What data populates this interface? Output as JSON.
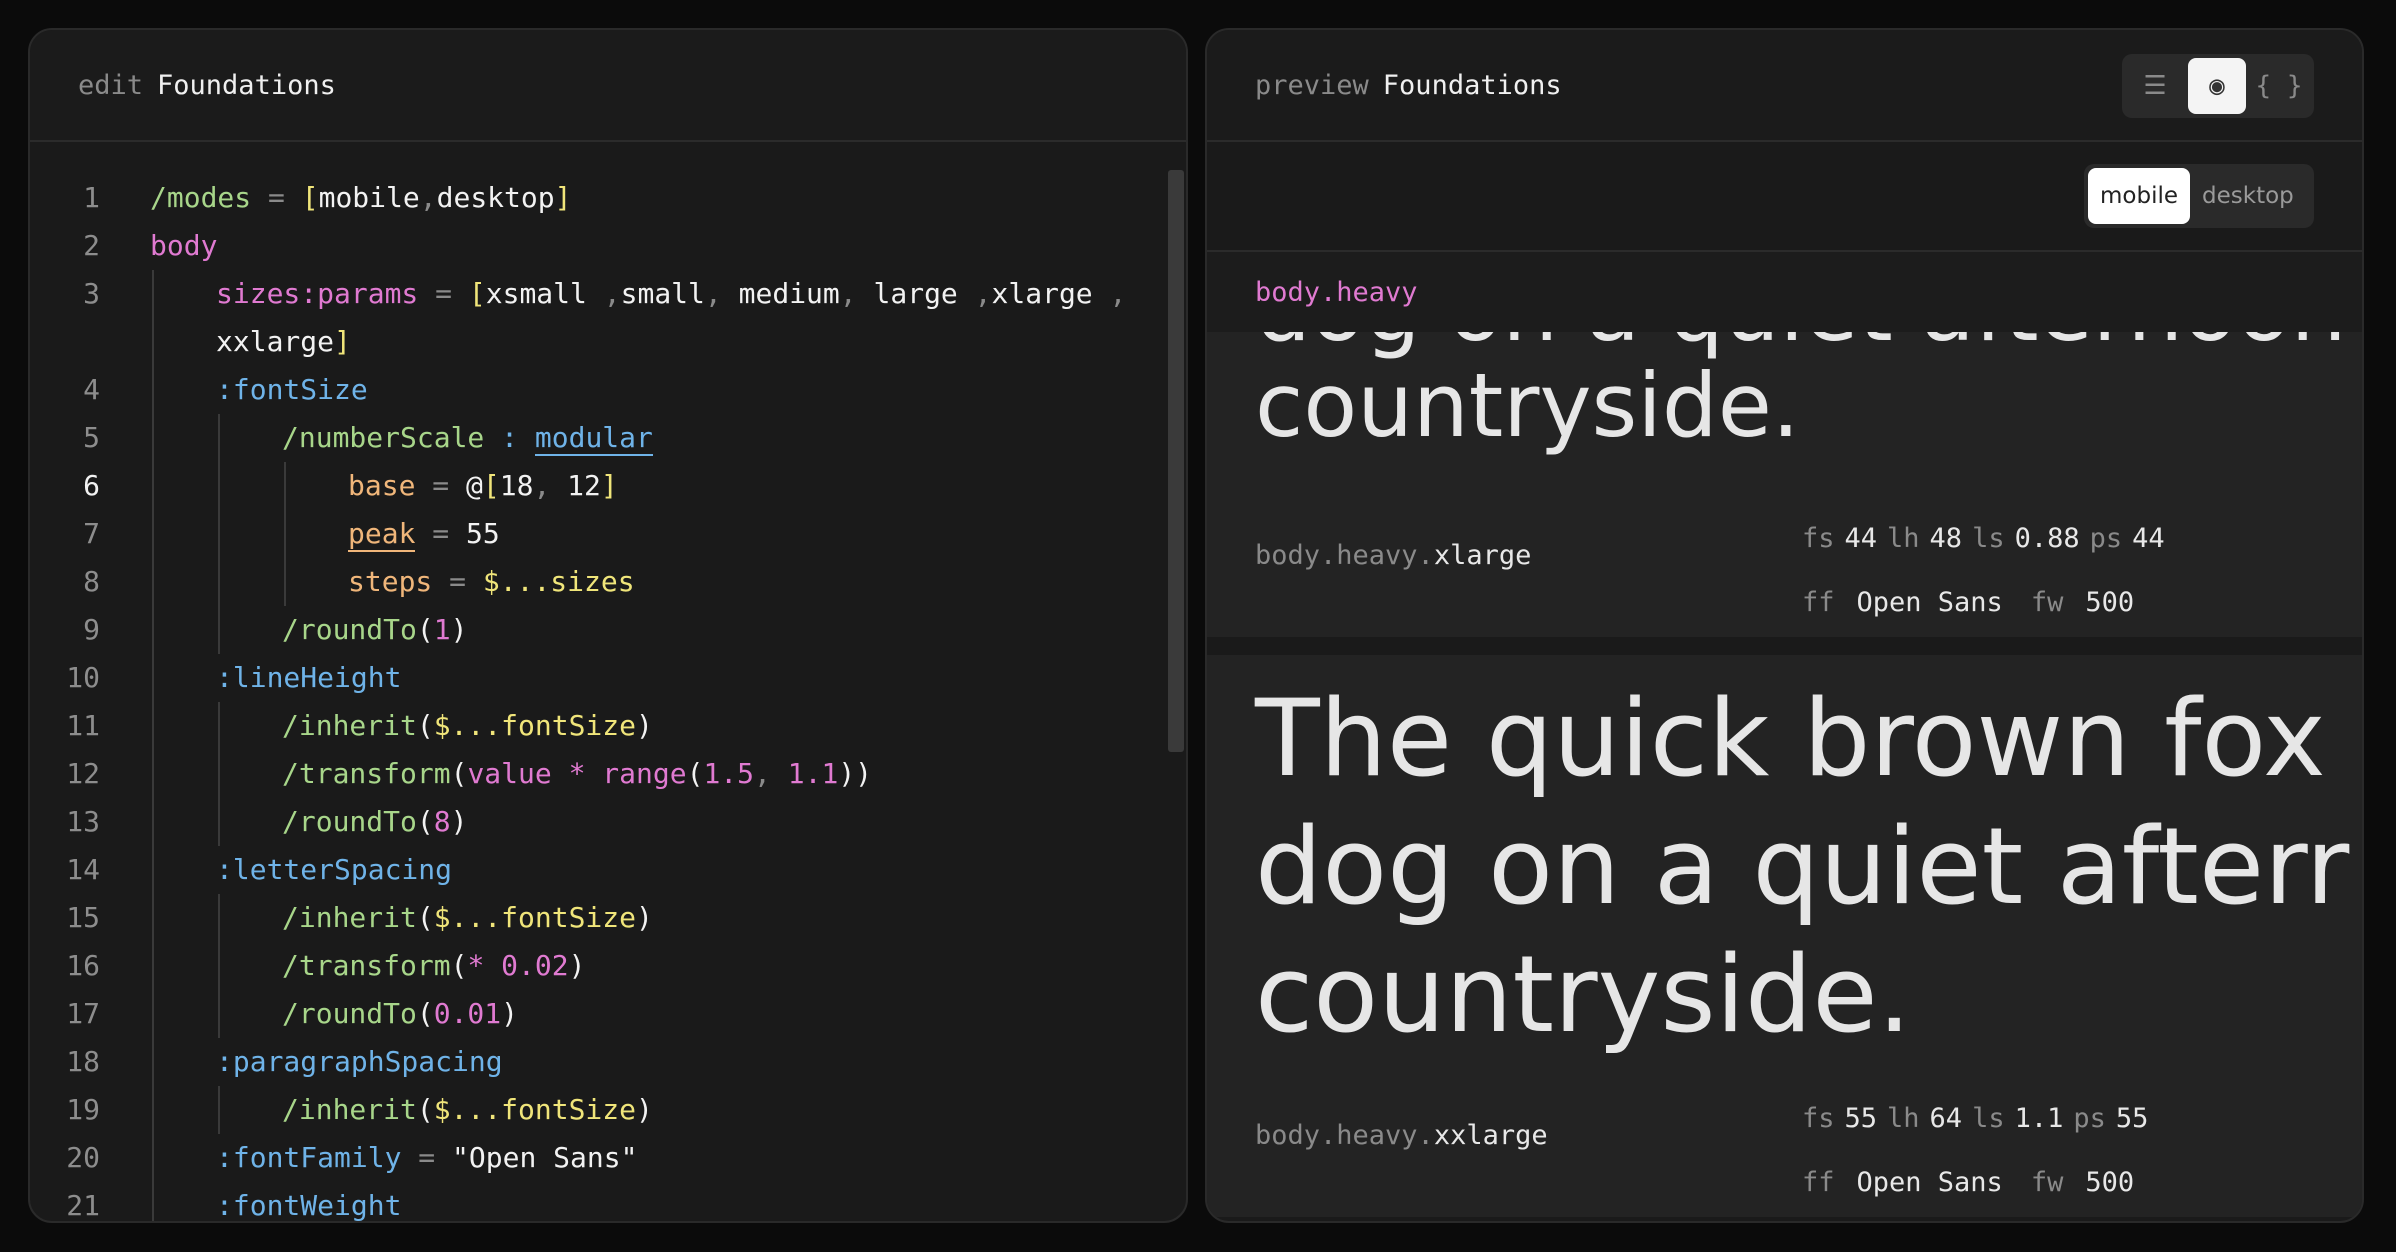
{
  "editor": {
    "mode_label": "edit",
    "title": "Foundations",
    "active_line": 6,
    "lines": [
      {
        "n": "1",
        "indent": 0,
        "tokens": [
          [
            "/modes",
            "green"
          ],
          [
            " = ",
            "gray"
          ],
          [
            "[",
            "yellow"
          ],
          [
            "mobile",
            "white"
          ],
          [
            ",",
            "gray"
          ],
          [
            "desktop",
            "white"
          ],
          [
            "]",
            "yellow"
          ]
        ]
      },
      {
        "n": "2",
        "indent": 0,
        "tokens": [
          [
            "body",
            "pink"
          ]
        ]
      },
      {
        "n": "3",
        "indent": 1,
        "tokens": [
          [
            "sizes:params",
            "pink"
          ],
          [
            " = ",
            "gray"
          ],
          [
            "[",
            "yellow"
          ],
          [
            "xsmall ",
            "white"
          ],
          [
            ",",
            "gray"
          ],
          [
            "small",
            "white"
          ],
          [
            ", ",
            "gray"
          ],
          [
            "medium",
            "white"
          ],
          [
            ", ",
            "gray"
          ],
          [
            "large ",
            "white"
          ],
          [
            ",",
            "gray"
          ],
          [
            "xlarge ",
            "white"
          ],
          [
            ",",
            "gray"
          ]
        ]
      },
      {
        "n": "",
        "indent": 1,
        "tokens": [
          [
            "xxlarge",
            "white"
          ],
          [
            "]",
            "yellow"
          ]
        ]
      },
      {
        "n": "4",
        "indent": 1,
        "tokens": [
          [
            ":fontSize",
            "blue"
          ]
        ]
      },
      {
        "n": "5",
        "indent": 2,
        "tokens": [
          [
            "/numberScale",
            "green"
          ],
          [
            " : ",
            "blue"
          ],
          [
            "modular",
            "blue-u"
          ]
        ]
      },
      {
        "n": "6",
        "indent": 3,
        "tokens": [
          [
            "base",
            "orange"
          ],
          [
            " = ",
            "gray"
          ],
          [
            "@",
            "white"
          ],
          [
            "[",
            "yellow"
          ],
          [
            "18",
            "white"
          ],
          [
            ", ",
            "gray"
          ],
          [
            "12",
            "white"
          ],
          [
            "]",
            "yellow"
          ]
        ]
      },
      {
        "n": "7",
        "indent": 3,
        "tokens": [
          [
            "peak",
            "orange-u"
          ],
          [
            " = ",
            "gray"
          ],
          [
            "55",
            "white"
          ]
        ]
      },
      {
        "n": "8",
        "indent": 3,
        "tokens": [
          [
            "steps",
            "orange"
          ],
          [
            " = ",
            "gray"
          ],
          [
            "$...sizes",
            "yellow"
          ]
        ]
      },
      {
        "n": "9",
        "indent": 2,
        "tokens": [
          [
            "/roundTo",
            "green"
          ],
          [
            "(",
            "white"
          ],
          [
            "1",
            "pink"
          ],
          [
            ")",
            "white"
          ]
        ]
      },
      {
        "n": "10",
        "indent": 1,
        "tokens": [
          [
            ":lineHeight",
            "blue"
          ]
        ]
      },
      {
        "n": "11",
        "indent": 2,
        "tokens": [
          [
            "/inherit",
            "green"
          ],
          [
            "(",
            "white"
          ],
          [
            "$...fontSize",
            "yellow"
          ],
          [
            ")",
            "white"
          ]
        ]
      },
      {
        "n": "12",
        "indent": 2,
        "tokens": [
          [
            "/transform",
            "green"
          ],
          [
            "(",
            "white"
          ],
          [
            "value * range",
            "pink"
          ],
          [
            "(",
            "white"
          ],
          [
            "1.5",
            "pink"
          ],
          [
            ", ",
            "gray"
          ],
          [
            "1.1",
            "pink"
          ],
          [
            "))",
            "white"
          ]
        ]
      },
      {
        "n": "13",
        "indent": 2,
        "tokens": [
          [
            "/roundTo",
            "green"
          ],
          [
            "(",
            "white"
          ],
          [
            "8",
            "pink"
          ],
          [
            ")",
            "white"
          ]
        ]
      },
      {
        "n": "14",
        "indent": 1,
        "tokens": [
          [
            ":letterSpacing",
            "blue"
          ]
        ]
      },
      {
        "n": "15",
        "indent": 2,
        "tokens": [
          [
            "/inherit",
            "green"
          ],
          [
            "(",
            "white"
          ],
          [
            "$...fontSize",
            "yellow"
          ],
          [
            ")",
            "white"
          ]
        ]
      },
      {
        "n": "16",
        "indent": 2,
        "tokens": [
          [
            "/transform",
            "green"
          ],
          [
            "(",
            "white"
          ],
          [
            "* 0.02",
            "pink"
          ],
          [
            ")",
            "white"
          ]
        ]
      },
      {
        "n": "17",
        "indent": 2,
        "tokens": [
          [
            "/roundTo",
            "green"
          ],
          [
            "(",
            "white"
          ],
          [
            "0.01",
            "pink"
          ],
          [
            ")",
            "white"
          ]
        ]
      },
      {
        "n": "18",
        "indent": 1,
        "tokens": [
          [
            ":paragraphSpacing",
            "blue"
          ]
        ]
      },
      {
        "n": "19",
        "indent": 2,
        "tokens": [
          [
            "/inherit",
            "green"
          ],
          [
            "(",
            "white"
          ],
          [
            "$...fontSize",
            "yellow"
          ],
          [
            ")",
            "white"
          ]
        ]
      },
      {
        "n": "20",
        "indent": 1,
        "tokens": [
          [
            ":fontFamily",
            "blue"
          ],
          [
            " = ",
            "gray"
          ],
          [
            "\"Open Sans\"",
            "white"
          ]
        ]
      },
      {
        "n": "21",
        "indent": 1,
        "tokens": [
          [
            ":fontWeight",
            "blue"
          ]
        ]
      }
    ]
  },
  "preview": {
    "mode_label": "preview",
    "title": "Foundations",
    "view_buttons": [
      {
        "icon": "list-icon",
        "glyph": "☰",
        "active": false
      },
      {
        "icon": "eye-icon",
        "glyph": "◉",
        "active": true
      },
      {
        "icon": "braces-icon",
        "glyph": "{ }",
        "active": false
      }
    ],
    "modes": [
      "mobile",
      "desktop"
    ],
    "active_mode": "mobile",
    "group_label": "body.heavy",
    "cards": [
      {
        "sample": "dog on a quiet afternoon\ncountryside.",
        "token_prefix": "body.heavy.",
        "token_last": "xlarge",
        "fs": "44",
        "lh": "48",
        "ls": "0.88",
        "ps": "44",
        "ff": "Open Sans",
        "fw": "500"
      },
      {
        "sample": "The quick brown fox\ndog on a quiet afterr\ncountryside.",
        "token_prefix": "body.heavy.",
        "token_last": "xxlarge",
        "fs": "55",
        "lh": "64",
        "ls": "1.1",
        "ps": "55",
        "ff": "Open Sans",
        "fw": "500"
      }
    ],
    "spec_keys": {
      "fs": "fs",
      "lh": "lh",
      "ls": "ls",
      "ps": "ps",
      "ff": "ff",
      "fw": "fw"
    }
  }
}
